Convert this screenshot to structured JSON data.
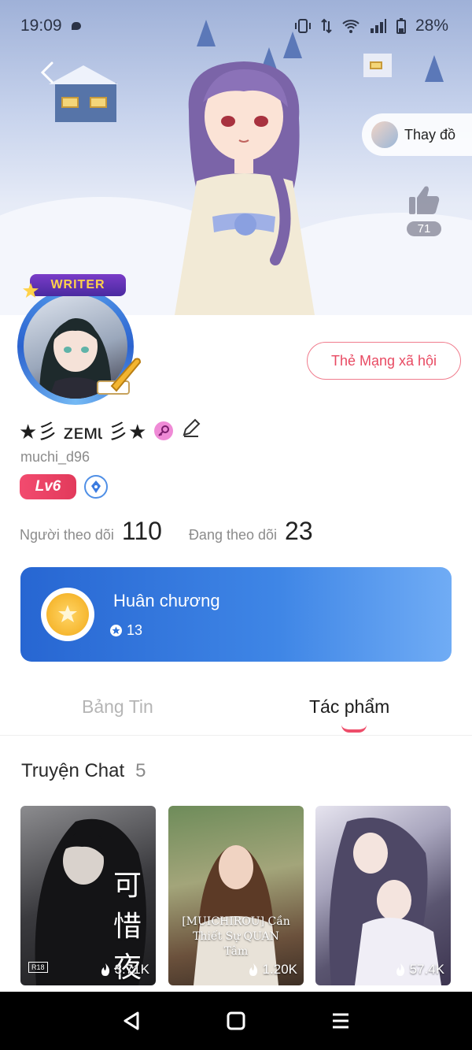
{
  "status_bar": {
    "time": "19:09",
    "battery": "28%"
  },
  "hero": {
    "change_outfit_label": "Thay đồ",
    "like_count": "71"
  },
  "profile": {
    "writer_badge": "WRITER",
    "social_card_button": "Thẻ Mạng xã hội",
    "nickname": "★彡 ᴢᴇᴍɩ 彡★",
    "username": "muchi_d96",
    "level": "Lv6",
    "followers_label": "Người theo dõi",
    "followers_count": "110",
    "following_label": "Đang theo dõi",
    "following_count": "23"
  },
  "medal": {
    "title": "Huân chương",
    "count": "13"
  },
  "tabs": [
    {
      "label": "Bảng Tin",
      "active": false
    },
    {
      "label": "Tác phẩm",
      "active": true
    }
  ],
  "section": {
    "title": "Truyện Chat",
    "count": "5"
  },
  "stories": [
    {
      "views": "3.71K",
      "cover_text": "可 惜 夜 の 熱",
      "cover_tag": "R18"
    },
    {
      "views": "1.20K",
      "cover_text": "[MUICHIROU] Cần Thiết Sự QUAN Tâm"
    },
    {
      "views": "57.4K"
    }
  ],
  "colors": {
    "accent_pink": "#e84a62",
    "medal_blue": "#2766d2",
    "level_red": "#f24b6f"
  }
}
